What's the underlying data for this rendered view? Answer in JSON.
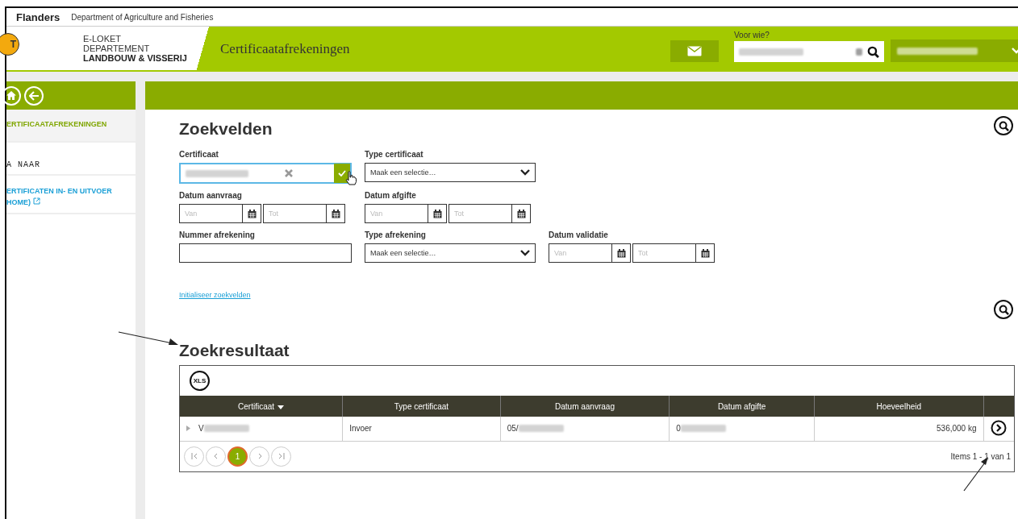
{
  "top_bar": {
    "brand": "Flanders",
    "department": "Department of Agriculture and Fisheries"
  },
  "header": {
    "logo_text": "T",
    "org_lines": [
      "E-LOKET",
      "DEPARTEMENT"
    ],
    "org_bold": "LANDBOUW & VISSERIJ",
    "title": "Certificaatafrekeningen",
    "for_whom_label": "Voor wie?"
  },
  "sidebar": {
    "items": [
      {
        "label": "ERTIFICAATAFREKENINGEN",
        "kind": "current"
      },
      {
        "label": "A NAAR",
        "kind": "heading"
      },
      {
        "label": "ERTIFICATEN IN- EN UITVOER",
        "label_2": "HOME)",
        "kind": "external"
      }
    ]
  },
  "search": {
    "title": "Zoekvelden",
    "rows": [
      [
        {
          "label": "Certificaat",
          "kind": "lookup"
        },
        {
          "label": "Type certificaat",
          "kind": "select",
          "value": "Maak een selectie…"
        }
      ],
      [
        {
          "label": "Datum aanvraag",
          "kind": "daterange",
          "from_placeholder": "Van",
          "to_placeholder": "Tot"
        },
        {
          "label": "Datum afgifte",
          "kind": "daterange",
          "from_placeholder": "Van",
          "to_placeholder": "Tot"
        }
      ],
      [
        {
          "label": "Nummer afrekening",
          "kind": "text"
        },
        {
          "label": "Type afrekening",
          "kind": "select",
          "value": "Maak een selectie…"
        },
        {
          "label": "Datum validatie",
          "kind": "daterange",
          "from_placeholder": "Van",
          "to_placeholder": "Tot"
        }
      ]
    ],
    "reset_link": "Initialiseer zoekvelden"
  },
  "results": {
    "title": "Zoekresultaat",
    "export": "XLS",
    "columns": [
      {
        "label": "Certificaat",
        "sorted": true
      },
      {
        "label": "Type certificaat",
        "sorted": false
      },
      {
        "label": "Datum aanvraag",
        "sorted": false
      },
      {
        "label": "Datum afgifte",
        "sorted": false
      },
      {
        "label": "Hoeveelheid",
        "sorted": false
      }
    ],
    "rows": [
      {
        "cells": [
          {
            "text": "V",
            "redacted": true
          },
          {
            "text": "Invoer",
            "redacted": false
          },
          {
            "text": "05/",
            "redacted": true
          },
          {
            "text": "0",
            "redacted": true
          },
          {
            "text": "536,000 kg",
            "redacted": false
          }
        ]
      }
    ],
    "pages": [
      {
        "label": "1",
        "selected": true
      }
    ],
    "summary": "Items 1 - 1 van 1"
  }
}
